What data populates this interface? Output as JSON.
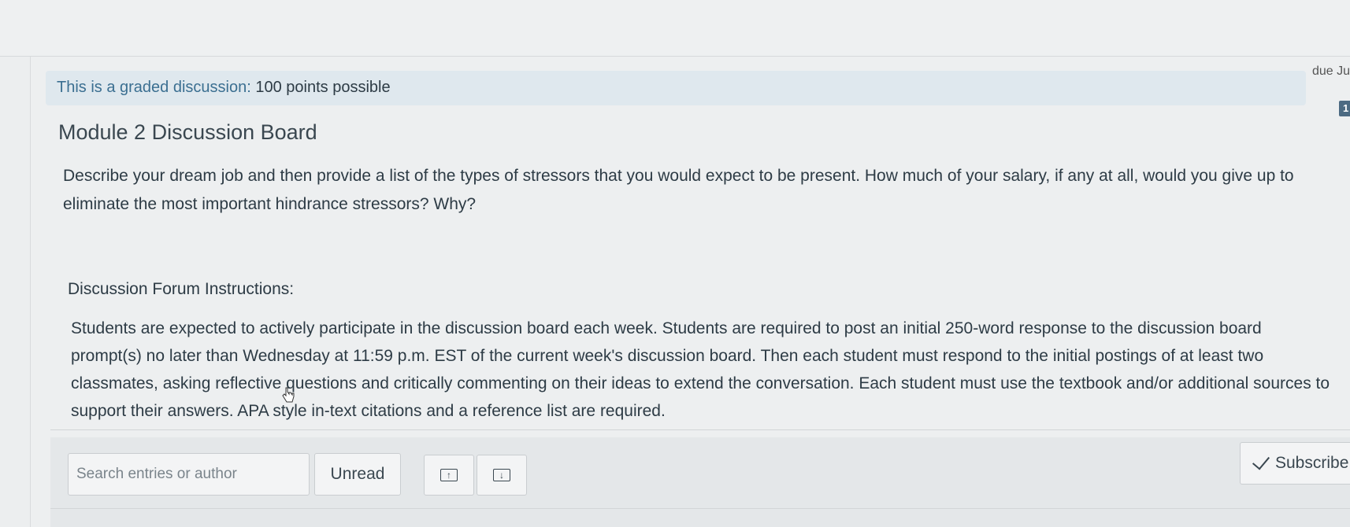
{
  "banner": {
    "graded_prefix": "This is a graded discussion: ",
    "points": "100 points possible",
    "due_label": "due Ju",
    "count_badge": "1"
  },
  "discussion": {
    "title": "Module 2 Discussion Board",
    "prompt": "Describe your dream job and then provide a list of the types of stressors that you would expect to be present. How much of your salary, if any at all, would you give up to eliminate the most important hindrance stressors? Why?",
    "instructions_heading": "Discussion Forum Instructions:",
    "instructions_body": "Students are expected to actively participate in the discussion board each week. Students are required to post an initial 250-word response to the discussion board prompt(s) no later than Wednesday at 11:59 p.m. EST of the current week's discussion board. Then each student must respond to the initial postings of at least two classmates, asking reflective questions and critically commenting on their ideas to extend the conversation. Each student must use the textbook and/or additional sources to support their answers. APA style in-text citations and a reference list are required."
  },
  "toolbar": {
    "search_placeholder": "Search entries or author",
    "unread_label": "Unread",
    "expand_icon": "arrow-up-box-icon",
    "collapse_icon": "arrow-down-box-icon",
    "subscribe_label": "Subscribe"
  }
}
